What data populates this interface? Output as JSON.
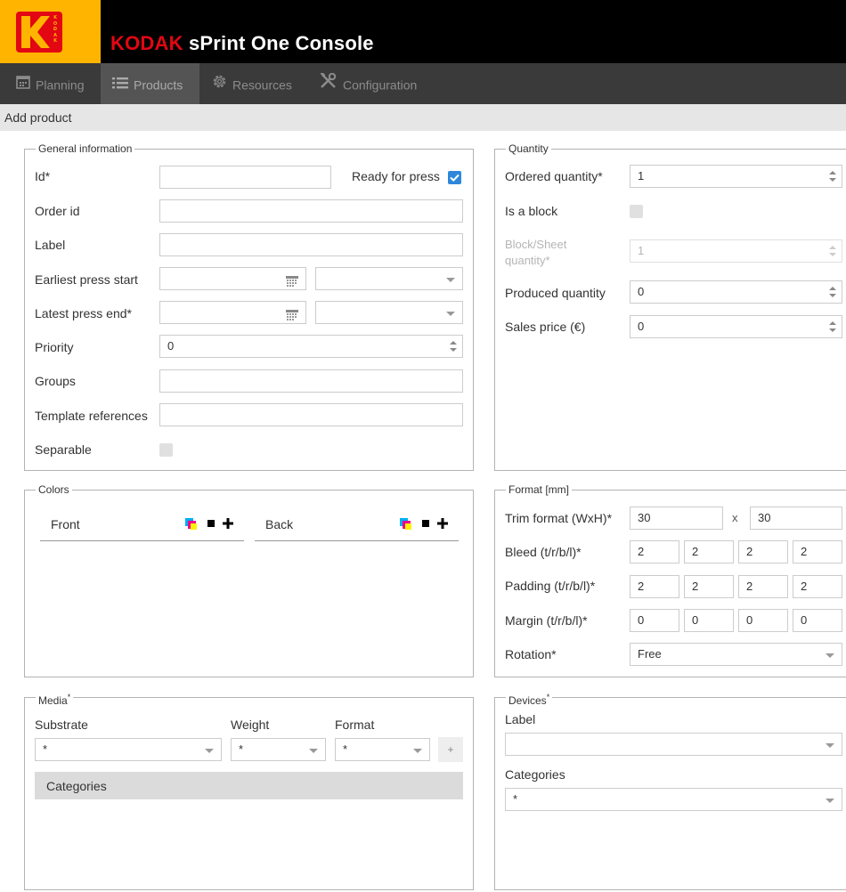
{
  "header": {
    "logo_text": "KODAK",
    "title_brand": "KODAK",
    "title_rest": " sPrint One Console",
    "colors": {
      "logo_bg": "#ffb400",
      "brand_red": "#e30613",
      "header_bg": "#000000"
    }
  },
  "nav": {
    "tabs": [
      {
        "label": "Planning",
        "icon": "calendar-icon"
      },
      {
        "label": "Products",
        "icon": "list-icon",
        "active": true
      },
      {
        "label": "Resources",
        "icon": "gear-icon"
      },
      {
        "label": "Configuration",
        "icon": "tools-icon"
      }
    ]
  },
  "subbar": {
    "title": "Add product"
  },
  "general": {
    "legend": "General information",
    "id_label": "Id*",
    "id_value": "",
    "ready_label": "Ready for press",
    "ready_checked": true,
    "order_id_label": "Order id",
    "order_id_value": "",
    "label_label": "Label",
    "label_value": "",
    "earliest_label": "Earliest press start",
    "earliest_date": "",
    "earliest_time": "",
    "latest_label": "Latest press end*",
    "latest_date": "",
    "latest_time": "",
    "priority_label": "Priority",
    "priority_value": "0",
    "groups_label": "Groups",
    "groups_value": "",
    "templates_label": "Template references",
    "templates_value": "",
    "separable_label": "Separable",
    "separable_checked": false
  },
  "quantity": {
    "legend": "Quantity",
    "ordered_label": "Ordered quantity*",
    "ordered_value": "1",
    "block_label": "Is a block",
    "block_checked": false,
    "block_sheet_label_1": "Block/Sheet",
    "block_sheet_label_2": "quantity*",
    "block_sheet_value": "1",
    "produced_label": "Produced quantity",
    "produced_value": "0",
    "sales_label": "Sales price (€)",
    "sales_value": "0"
  },
  "colors": {
    "legend": "Colors",
    "front_label": "Front",
    "back_label": "Back"
  },
  "format": {
    "legend": "Format [mm]",
    "trim_label": "Trim format (WxH)*",
    "trim_w": "30",
    "trim_sep": "x",
    "trim_h": "30",
    "bleed_label": "Bleed (t/r/b/l)*",
    "bleed": [
      "2",
      "2",
      "2",
      "2"
    ],
    "padding_label": "Padding (t/r/b/l)*",
    "padding": [
      "2",
      "2",
      "2",
      "2"
    ],
    "margin_label": "Margin (t/r/b/l)*",
    "margin": [
      "0",
      "0",
      "0",
      "0"
    ],
    "rotation_label": "Rotation*",
    "rotation_value": "Free"
  },
  "media": {
    "legend": "Media",
    "legend_mark": "*",
    "substrate_label": "Substrate",
    "substrate_value": "*",
    "weight_label": "Weight",
    "weight_value": "*",
    "format_label": "Format",
    "format_value": "*",
    "add_label": "+",
    "categories_label": "Categories"
  },
  "devices": {
    "legend": "Devices",
    "legend_mark": "*",
    "label_label": "Label",
    "label_value": "",
    "categories_label": "Categories",
    "categories_value": "*"
  }
}
